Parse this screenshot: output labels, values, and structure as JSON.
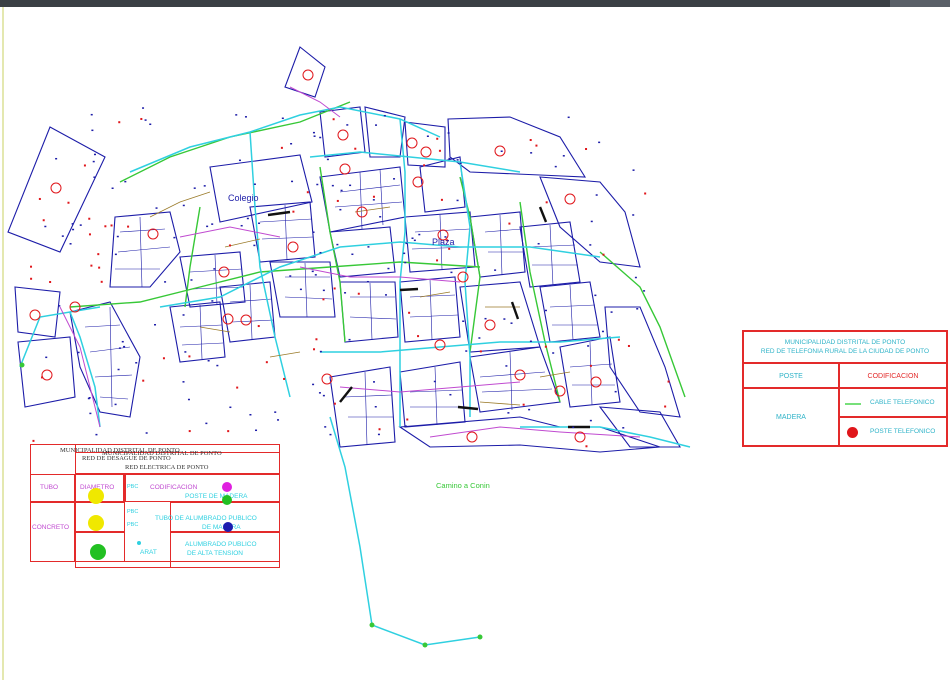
{
  "map": {
    "labels": {
      "colegio": "Colegio",
      "plaza": "Plaza",
      "camino": "Camino a Conin"
    },
    "colors": {
      "block_outline": "#1c1ca8",
      "street_main": "#2fd0e0",
      "street_secondary": "#37c837",
      "pipe": "#c04ad0",
      "property_fill_line": "#9a7a28",
      "road_path": "#2fd0e0",
      "pole_marker": "#e0161b",
      "annotation": "#1c1ca8"
    }
  },
  "legend_right": {
    "title_line1": "MUNICIPALIDAD DISTRITAL DE PONTO",
    "title_line2": "RED DE TELEFONIA RURAL DE LA CIUDAD DE PONTO",
    "col1_header": "POSTE",
    "col2_header": "CODIFICACION",
    "row_material": "MADERA",
    "item1": "CABLE TELEFONICO",
    "item2": "POSTE TELEFONICO"
  },
  "legend_left": {
    "title_a1": "MUNICIPALIDAD DISTRITAL DE PONTO",
    "title_a2": "RED DE DESAGUE DE PONTO",
    "title_b1": "MUNICIPALIDAD DISTRITAL DE PONTO",
    "title_b2": "RED ELECTRICA DE PONTO",
    "tubo": "TUBO",
    "diametro": "DIAMETRO",
    "codificacion": "CODIFICACION",
    "concreto": "CONCRETO",
    "poste_madera": "POSTE DE MADERA",
    "tuberia_publico": "TUBO DE ALUMBRADO PUBLICO",
    "de_madera": "DE MADERA",
    "alumbrado_publico": "ALUMBRADO PUBLICO",
    "alta_tension": "DE ALTA TENSION",
    "pbc1": "PBC",
    "pbc2": "PBC",
    "pbc3": "PBC",
    "arat": "ARAT"
  }
}
